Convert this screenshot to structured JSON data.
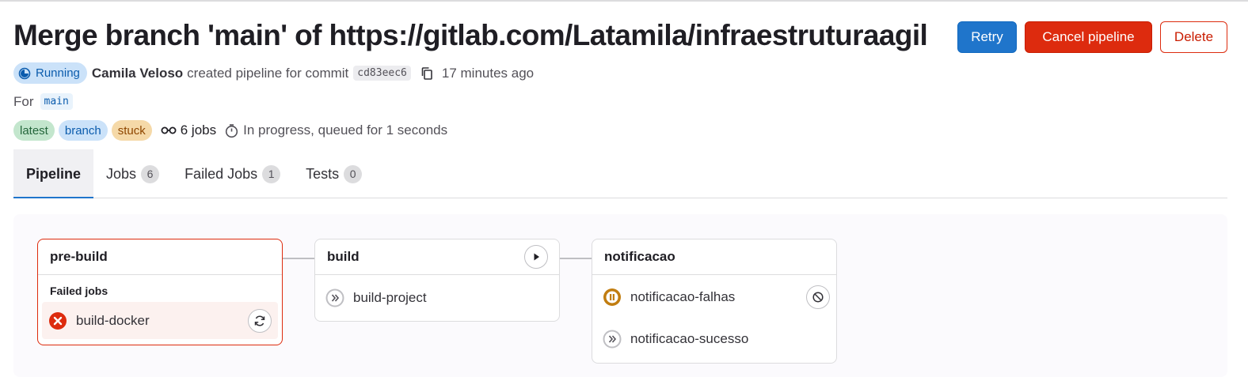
{
  "pipeline": {
    "title": "Merge branch 'main' of https://gitlab.com/Latamila/infraestruturaagil",
    "status": "Running",
    "author": "Camila Veloso",
    "created_text": "created pipeline for commit",
    "commit_sha": "cd83eec6",
    "time_ago": "17 minutes ago",
    "for_label": "For",
    "ref": "main",
    "badges": [
      "latest",
      "branch",
      "stuck"
    ],
    "jobs_count": "6 jobs",
    "progress_text": "In progress, queued for 1 seconds"
  },
  "actions": {
    "retry": "Retry",
    "cancel": "Cancel pipeline",
    "delete": "Delete"
  },
  "tabs": [
    {
      "label": "Pipeline",
      "count": null
    },
    {
      "label": "Jobs",
      "count": "6"
    },
    {
      "label": "Failed Jobs",
      "count": "1"
    },
    {
      "label": "Tests",
      "count": "0"
    }
  ],
  "stages": [
    {
      "name": "pre-build",
      "section_label": "Failed jobs",
      "jobs": [
        {
          "name": "build-docker",
          "status": "failed",
          "action": "retry"
        }
      ]
    },
    {
      "name": "build",
      "jobs": [
        {
          "name": "build-project",
          "status": "skipped"
        }
      ],
      "action": "play"
    },
    {
      "name": "notificacao",
      "jobs": [
        {
          "name": "notificacao-falhas",
          "status": "manual-paused",
          "action": "cancel"
        },
        {
          "name": "notificacao-sucesso",
          "status": "skipped"
        }
      ]
    }
  ],
  "colors": {
    "primary": "#1f75cb",
    "danger": "#dd2b0e",
    "running": "#0b5cad",
    "warning": "#c17d10"
  },
  "icons": [
    "running-status-icon",
    "copy-icon",
    "jobs-icon",
    "timer-icon",
    "failed-status-icon",
    "retry-icon",
    "play-icon",
    "skipped-status-icon",
    "paused-status-icon",
    "cancel-icon"
  ]
}
